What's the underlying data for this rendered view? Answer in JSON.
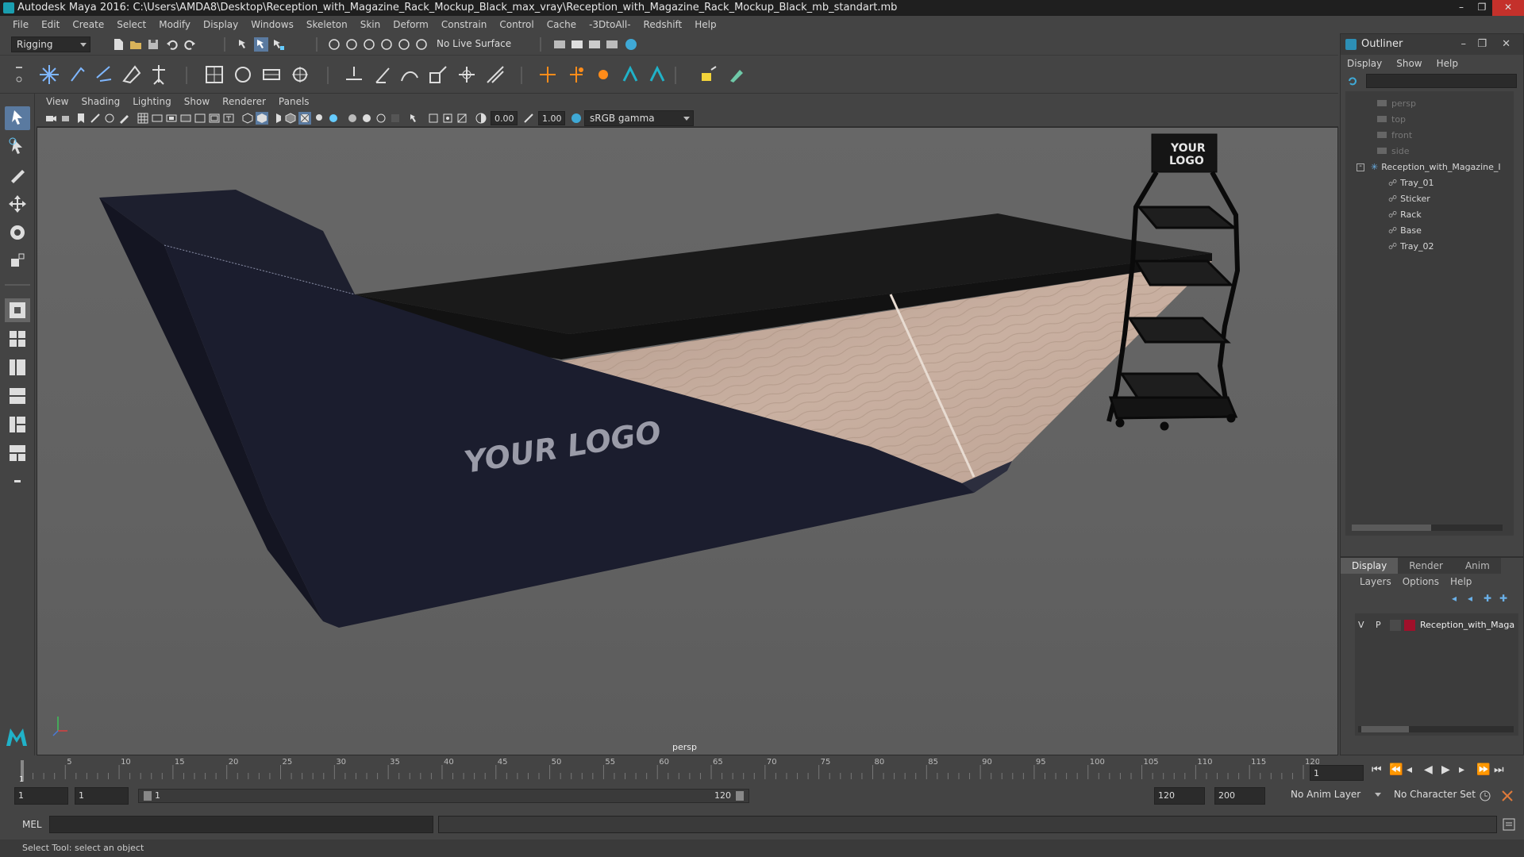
{
  "window": {
    "title": "Autodesk Maya 2016: C:\\Users\\AMDA8\\Desktop\\Reception_with_Magazine_Rack_Mockup_Black_max_vray\\Reception_with_Magazine_Rack_Mockup_Black_mb_standart.mb",
    "controls": [
      "–",
      "❐",
      "✕"
    ]
  },
  "menubar": [
    "File",
    "Edit",
    "Create",
    "Select",
    "Modify",
    "Display",
    "Windows",
    "Skeleton",
    "Skin",
    "Deform",
    "Constrain",
    "Control",
    "Cache",
    "-3DtoAll-",
    "Redshift",
    "Help"
  ],
  "statusline": {
    "menuset": "Rigging",
    "live_surface": "No Live Surface"
  },
  "panel_menu": [
    "View",
    "Shading",
    "Lighting",
    "Show",
    "Renderer",
    "Panels"
  ],
  "view_toolbar": {
    "exposure": "0.00",
    "gamma": "1.00",
    "color_space": "sRGB gamma"
  },
  "viewport": {
    "camera_label": "persp",
    "logo_text_desk": "YOUR LOGO",
    "logo_text_rack": [
      "YOUR",
      "LOGO"
    ]
  },
  "outliner": {
    "title": "Outliner",
    "menu": [
      "Display",
      "Show",
      "Help"
    ],
    "cameras": [
      "persp",
      "top",
      "front",
      "side"
    ],
    "root": "Reception_with_Magazine_I",
    "children": [
      "Tray_01",
      "Sticker",
      "Rack",
      "Base",
      "Tray_02"
    ]
  },
  "layers": {
    "tabs": [
      "Display",
      "Render",
      "Anim"
    ],
    "menu": [
      "Layers",
      "Options",
      "Help"
    ],
    "row": {
      "v": "V",
      "p": "P",
      "name": "Reception_with_Maga",
      "color": "#a0102a"
    }
  },
  "timeline": {
    "ticks": [
      "5",
      "10",
      "15",
      "20",
      "25",
      "30",
      "35",
      "40",
      "45",
      "50",
      "55",
      "60",
      "65",
      "70",
      "75",
      "80",
      "85",
      "90",
      "95",
      "100",
      "105",
      "110",
      "115",
      "120"
    ],
    "current_frame_label": "1",
    "current_frame_field": "1"
  },
  "range": {
    "start": "1",
    "playback_start": "1",
    "slider_start": "1",
    "slider_end": "120",
    "playback_end": "120",
    "end": "200",
    "anim_layer": "No Anim Layer",
    "character_set": "No Character Set"
  },
  "cmdline": {
    "label": "MEL"
  },
  "helpline": {
    "text": "Select Tool: select an object"
  },
  "colors": {
    "desk_navy": "#1b1d2e",
    "desk_top": "#1c1c1c",
    "wood": "#c4a898",
    "viewport_bg": "#656565"
  }
}
